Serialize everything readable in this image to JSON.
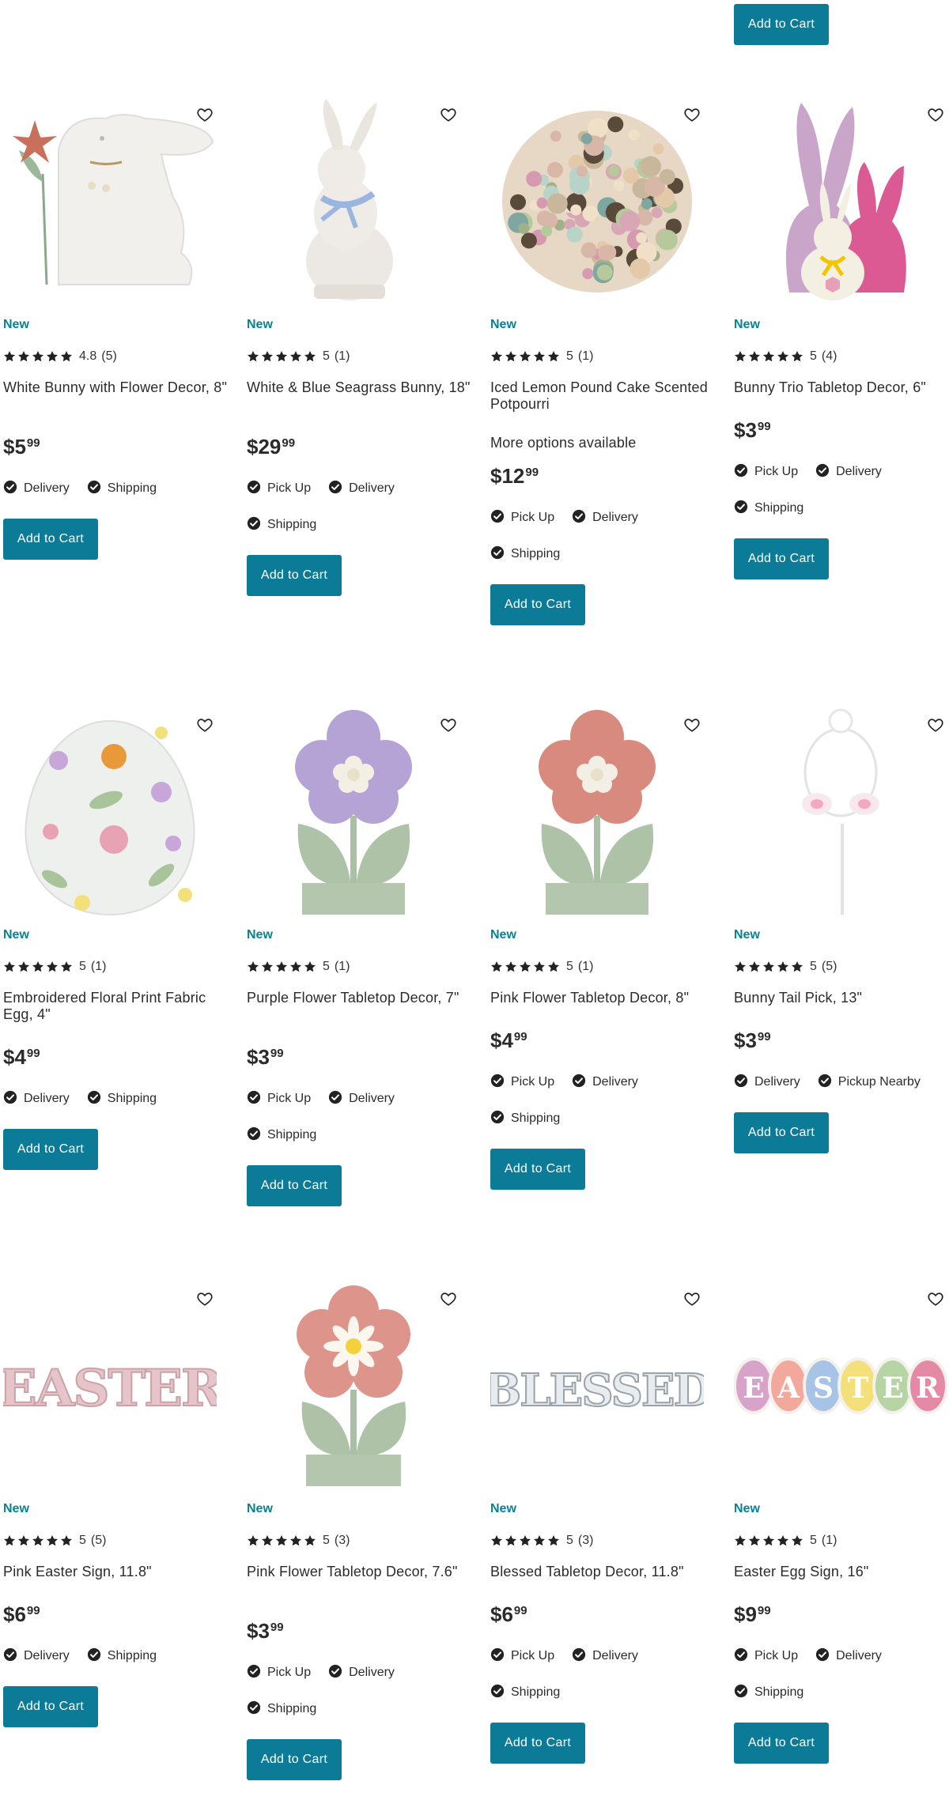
{
  "top_button": "Add to Cart",
  "products": [
    {
      "badge": "New",
      "rating": "4.8",
      "reviews": "(5)",
      "title": "White Bunny with Flower Decor, 8\"",
      "more": "",
      "price_dollars": "$5",
      "price_cents": "99",
      "fulfillment": [
        "Delivery",
        "Shipping"
      ],
      "button": "Add to Cart",
      "icon": "white-bunny-flower-image"
    },
    {
      "badge": "New",
      "rating": "5",
      "reviews": "(1)",
      "title": "White & Blue Seagrass Bunny, 18\"",
      "more": "",
      "price_dollars": "$29",
      "price_cents": "99",
      "fulfillment": [
        "Pick Up",
        "Delivery",
        "Shipping"
      ],
      "button": "Add to Cart",
      "icon": "seagrass-bunny-image"
    },
    {
      "badge": "New",
      "rating": "5",
      "reviews": "(1)",
      "title": "Iced Lemon Pound Cake Scented Potpourri",
      "more": "More options available",
      "price_dollars": "$12",
      "price_cents": "99",
      "fulfillment": [
        "Pick Up",
        "Delivery",
        "Shipping"
      ],
      "button": "Add to Cart",
      "icon": "potpourri-image"
    },
    {
      "badge": "New",
      "rating": "5",
      "reviews": "(4)",
      "title": "Bunny Trio Tabletop Decor, 6\"",
      "more": "",
      "price_dollars": "$3",
      "price_cents": "99",
      "fulfillment": [
        "Pick Up",
        "Delivery",
        "Shipping"
      ],
      "button": "Add to Cart",
      "icon": "bunny-trio-image"
    },
    {
      "badge": "New",
      "rating": "5",
      "reviews": "(1)",
      "title": "Embroidered Floral Print Fabric Egg, 4\"",
      "more": "",
      "price_dollars": "$4",
      "price_cents": "99",
      "fulfillment": [
        "Delivery",
        "Shipping"
      ],
      "button": "Add to Cart",
      "icon": "floral-egg-image"
    },
    {
      "badge": "New",
      "rating": "5",
      "reviews": "(1)",
      "title": "Purple Flower Tabletop Decor, 7\"",
      "more": "",
      "price_dollars": "$3",
      "price_cents": "99",
      "fulfillment": [
        "Pick Up",
        "Delivery",
        "Shipping"
      ],
      "button": "Add to Cart",
      "icon": "purple-flower-image"
    },
    {
      "badge": "New",
      "rating": "5",
      "reviews": "(1)",
      "title": "Pink Flower Tabletop Decor, 8\"",
      "more": "",
      "price_dollars": "$4",
      "price_cents": "99",
      "fulfillment": [
        "Pick Up",
        "Delivery",
        "Shipping"
      ],
      "button": "Add to Cart",
      "icon": "pink-flower-image"
    },
    {
      "badge": "New",
      "rating": "5",
      "reviews": "(5)",
      "title": "Bunny Tail Pick, 13\"",
      "more": "",
      "price_dollars": "$3",
      "price_cents": "99",
      "fulfillment": [
        "Delivery",
        "Pickup Nearby"
      ],
      "button": "Add to Cart",
      "icon": "bunny-tail-pick-image"
    },
    {
      "badge": "New",
      "rating": "5",
      "reviews": "(5)",
      "title": "Pink Easter Sign, 11.8\"",
      "more": "",
      "price_dollars": "$6",
      "price_cents": "99",
      "fulfillment": [
        "Delivery",
        "Shipping"
      ],
      "button": "Add to Cart",
      "icon": "easter-sign-image",
      "sign_text": "EASTER"
    },
    {
      "badge": "New",
      "rating": "5",
      "reviews": "(3)",
      "title": "Pink Flower Tabletop Decor, 7.6\"",
      "more": "",
      "price_dollars": "$3",
      "price_cents": "99",
      "fulfillment": [
        "Pick Up",
        "Delivery",
        "Shipping"
      ],
      "button": "Add to Cart",
      "icon": "pink-daisy-flower-image"
    },
    {
      "badge": "New",
      "rating": "5",
      "reviews": "(3)",
      "title": "Blessed Tabletop Decor, 11.8\"",
      "more": "",
      "price_dollars": "$6",
      "price_cents": "99",
      "fulfillment": [
        "Pick Up",
        "Delivery",
        "Shipping"
      ],
      "button": "Add to Cart",
      "icon": "blessed-sign-image",
      "sign_text": "BLESSED"
    },
    {
      "badge": "New",
      "rating": "5",
      "reviews": "(1)",
      "title": "Easter Egg Sign, 16\"",
      "more": "",
      "price_dollars": "$9",
      "price_cents": "99",
      "fulfillment": [
        "Pick Up",
        "Delivery",
        "Shipping"
      ],
      "button": "Add to Cart",
      "icon": "easter-egg-sign-image",
      "egg_letters": [
        "E",
        "A",
        "S",
        "T",
        "E",
        "R"
      ]
    }
  ],
  "colors": {
    "accent": "#0b7b98",
    "badge": "#0b7f93",
    "text": "#2b2b2b"
  }
}
